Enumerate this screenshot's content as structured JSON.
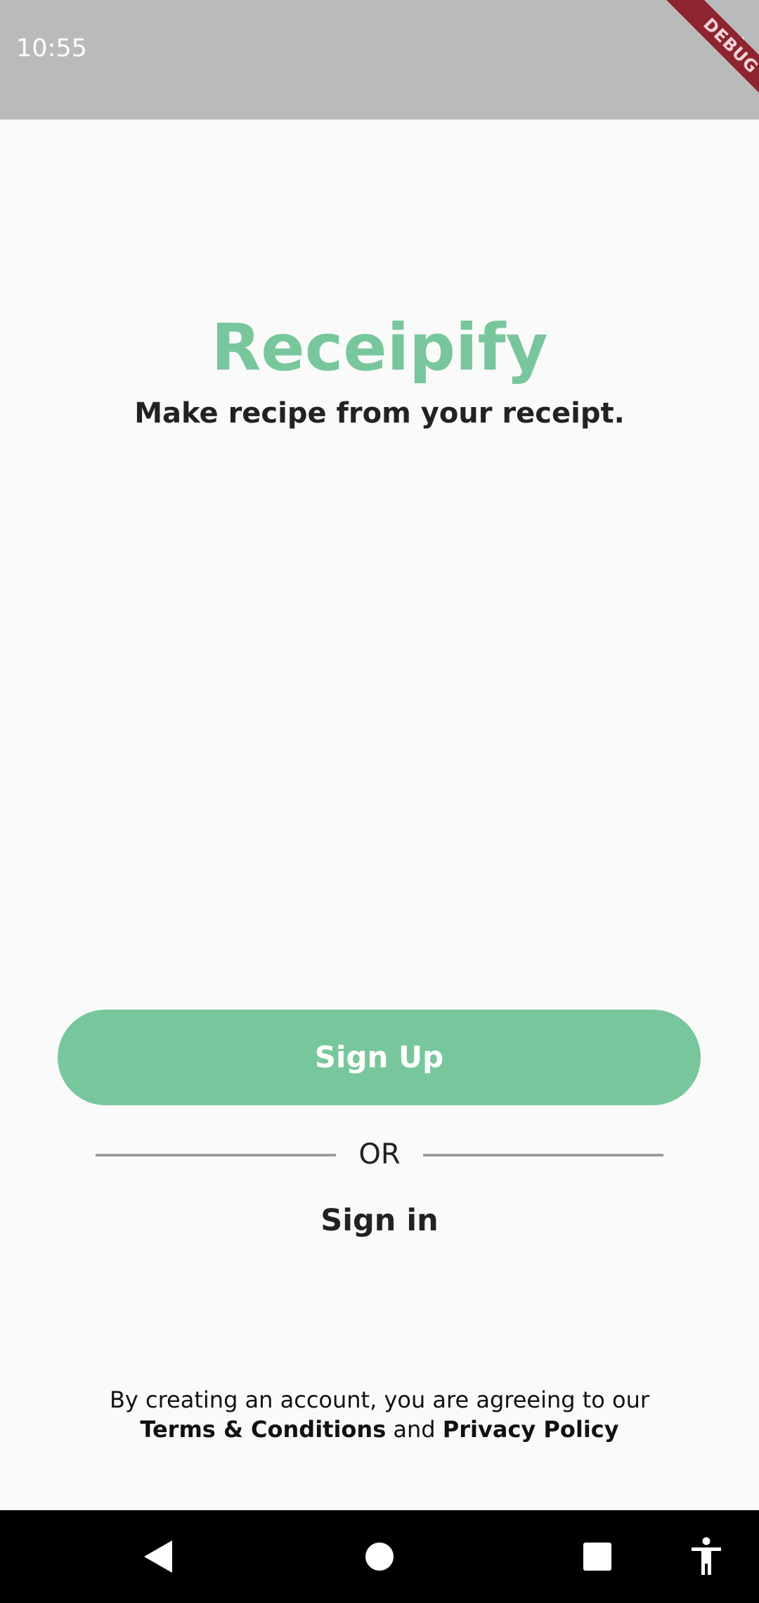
{
  "status_bar": {
    "time": "10:55",
    "battery_icon": "battery-full-icon"
  },
  "debug_banner": {
    "label": "DEBUG",
    "color": "#8e2430"
  },
  "app": {
    "title": "Receipify",
    "tagline": "Make recipe from your receipt.",
    "accent_color": "#78c79c"
  },
  "auth": {
    "signup_label": "Sign Up",
    "or_label": "OR",
    "signin_label": "Sign in"
  },
  "legal": {
    "line1": "By creating an account, you are agreeing to our",
    "terms_label": "Terms & Conditions",
    "and_label": "and",
    "privacy_label": "Privacy Policy"
  },
  "nav_bar": {
    "icons": [
      "back-icon",
      "home-icon",
      "recents-icon",
      "accessibility-icon"
    ]
  }
}
